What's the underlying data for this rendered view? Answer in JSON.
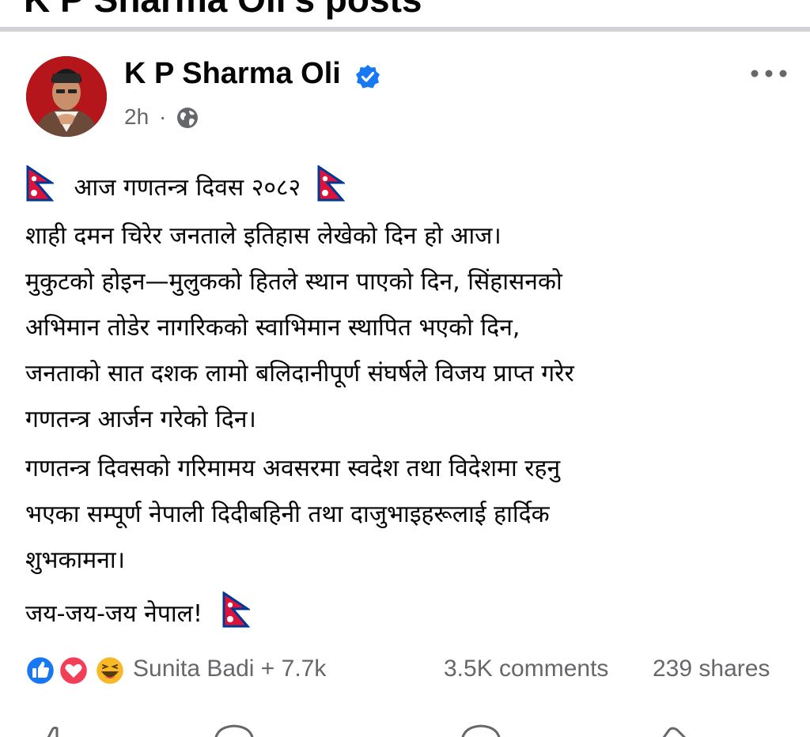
{
  "section_header": "K P Sharma Oli's posts",
  "post": {
    "author": "K P Sharma Oli",
    "time": "2h",
    "separator": "·",
    "lines": [
      "आज गणतन्त्र दिवस २०८२",
      "शाही दमन चिरेर जनताले इतिहास लेखेको दिन हो आज।",
      "मुकुटको होइन—मुलुकको हितले स्थान पाएको दिन, सिंहासनको",
      "अभिमान तोडेर नागरिकको स्वाभिमान स्थापित भएको दिन,",
      "जनताको सात दशक लामो बलिदानीपूर्ण संघर्षले विजय प्राप्त गरेर",
      "गणतन्त्र आर्जन गरेको दिन।",
      "गणतन्त्र दिवसको गरिमामय अवसरमा स्वदेश तथा विदेशमा रहनु",
      "भएका सम्पूर्ण नेपाली दिदीबहिनी तथा दाजुभाइहरूलाई हार्दिक",
      "शुभकामना।",
      "जय-जय-जय नेपाल!"
    ]
  },
  "engagement": {
    "reactions_text": "Sunita Badi + 7.7k",
    "comments": "3.5K comments",
    "shares": "239 shares"
  },
  "icons": {
    "verified": "verified-badge-icon",
    "globe": "globe-icon",
    "more": "more-options-icon",
    "like": "like-reaction-icon",
    "love": "love-reaction-icon",
    "haha": "haha-reaction-icon",
    "flag": "nepal-flag-icon"
  },
  "colors": {
    "verified_blue": "#1877f2",
    "muted_text": "#65676b",
    "love_red": "#f33e58",
    "haha_yellow": "#f7b928",
    "flag_red": "#dc143c",
    "flag_blue": "#003893"
  }
}
